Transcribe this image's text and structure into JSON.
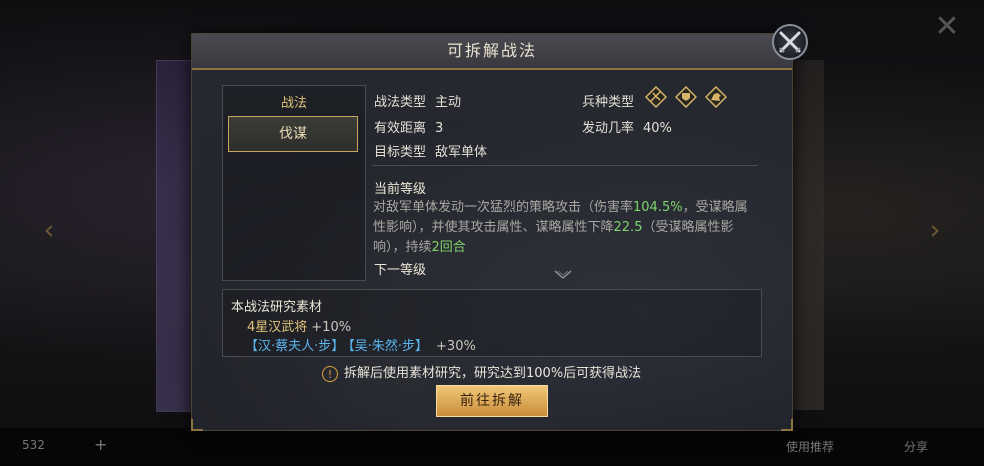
{
  "background": {
    "bottom_count": "532",
    "recommend_label": "使用推荐",
    "share_label": "分享"
  },
  "dialog": {
    "title": "可拆解战法",
    "skill_panel": {
      "label": "战法",
      "selected_skill": "伐谋"
    },
    "info": {
      "skill_type_label": "战法类型",
      "skill_type_value": "主动",
      "troop_type_label": "兵种类型",
      "troop_icons": [
        "crossbow-icon",
        "shield-icon",
        "cavalry-icon"
      ],
      "range_label": "有效距离",
      "range_value": "3",
      "trigger_label": "发动几率",
      "trigger_value": "40%",
      "target_label": "目标类型",
      "target_value": "敌军单体"
    },
    "current_level_heading": "当前等级",
    "description": {
      "part1": "对敌军单体发动一次猛烈的策略攻击（伤害率",
      "rate1": "104.5%",
      "part2": "，受谋略属性影响），并使其攻击属性、谋略属性下降",
      "rate2": "22.5",
      "part3": "（受谋略属性影响），持续",
      "duration": "2回合"
    },
    "next_level_heading": "下一等级",
    "materials": {
      "title": "本战法研究素材",
      "general_line": "4星汉武将",
      "general_pct": "+10%",
      "tag1": "【汉·蔡夫人·步】",
      "tag2": "【吴·朱然·步】",
      "tags_pct": "+30%"
    },
    "notice_icon": "!",
    "notice": "拆解后使用素材研究，研究达到100%后可获得战法",
    "go_button": "前往拆解"
  },
  "colors": {
    "gold": "#e2c27a",
    "green_value": "#7fd36a",
    "blue_tag": "#5ab4ee",
    "button": "#e0ac5a"
  }
}
